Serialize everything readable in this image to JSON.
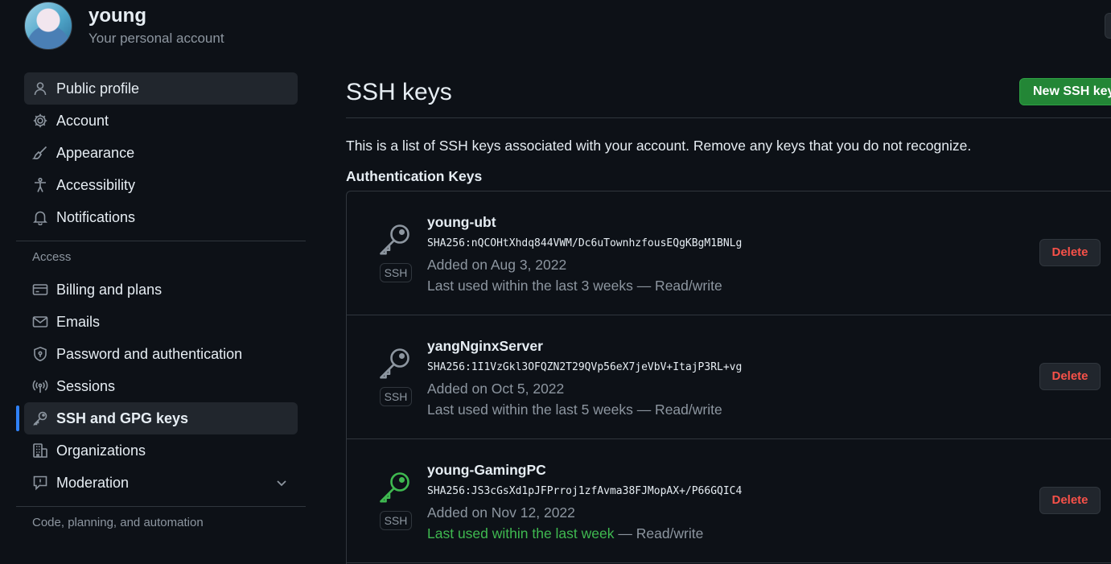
{
  "user": {
    "name": "young",
    "subtitle": "Your personal account"
  },
  "sidebar": {
    "items": [
      {
        "label": "Public profile",
        "icon": "person-icon"
      },
      {
        "label": "Account",
        "icon": "gear-icon"
      },
      {
        "label": "Appearance",
        "icon": "paintbrush-icon"
      },
      {
        "label": "Accessibility",
        "icon": "accessibility-icon"
      },
      {
        "label": "Notifications",
        "icon": "bell-icon"
      }
    ],
    "access_label": "Access",
    "access_items": [
      {
        "label": "Billing and plans",
        "icon": "credit-card-icon"
      },
      {
        "label": "Emails",
        "icon": "mail-icon"
      },
      {
        "label": "Password and authentication",
        "icon": "shield-lock-icon"
      },
      {
        "label": "Sessions",
        "icon": "broadcast-icon"
      },
      {
        "label": "SSH and GPG keys",
        "icon": "key-icon"
      },
      {
        "label": "Organizations",
        "icon": "organization-icon"
      },
      {
        "label": "Moderation",
        "icon": "report-icon"
      }
    ],
    "code_label": "Code, planning, and automation"
  },
  "main": {
    "title": "SSH keys",
    "new_button": "New SSH key",
    "intro": "This is a list of SSH keys associated with your account. Remove any keys that you do not recognize.",
    "section_title": "Authentication Keys",
    "keys": [
      {
        "title": "young-ubt",
        "fingerprint": "SHA256:nQCOHtXhdq844VWM/Dc6uTownhzfousEQgKBgM1BNLg",
        "added": "Added on Aug 3, 2022",
        "used": "Last used within the last 3 weeks — Read/write",
        "badge": "SSH",
        "delete": "Delete"
      },
      {
        "title": "yangNginxServer",
        "fingerprint": "SHA256:1I1VzGkl3OFQZN2T29QVp56eX7jeVbV+ItajP3RL+vg",
        "added": "Added on Oct 5, 2022",
        "used": "Last used within the last 5 weeks — Read/write",
        "badge": "SSH",
        "delete": "Delete"
      },
      {
        "title": "young-GamingPC",
        "fingerprint": "SHA256:JS3cGsXd1pJFPrroj1zfAvma38FJMopAX+/P66GQIC4",
        "added": "Added on Nov 12, 2022",
        "used_recent": "Last used within the last week",
        "used_rest": " — Read/write",
        "badge": "SSH",
        "delete": "Delete"
      }
    ]
  },
  "colors": {
    "background": "#0d1117",
    "accent_blue": "#2f81f7",
    "primary_green": "#238636",
    "recent_green": "#3fb950",
    "danger_red": "#f85149",
    "muted_text": "#8d96a0"
  }
}
